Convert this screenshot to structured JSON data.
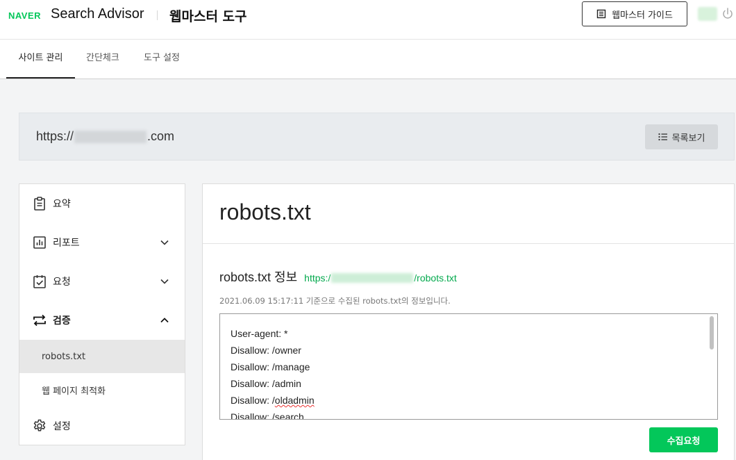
{
  "header": {
    "logo": "NAVER",
    "app_name": "Search Advisor",
    "tool_name": "웹마스터 도구",
    "guide_label": "웹마스터 가이드"
  },
  "tabs": [
    {
      "label": "사이트 관리",
      "active": true
    },
    {
      "label": "간단체크",
      "active": false
    },
    {
      "label": "도구 설정",
      "active": false
    }
  ],
  "site": {
    "url_prefix": "https://",
    "url_suffix": ".com",
    "list_label": "목록보기"
  },
  "sidebar": {
    "items": [
      {
        "label": "요약",
        "icon": "clipboard-icon"
      },
      {
        "label": "리포트",
        "icon": "chart-icon",
        "expanded": false
      },
      {
        "label": "요청",
        "icon": "clipboard-check-icon",
        "expanded": false
      },
      {
        "label": "검증",
        "icon": "repeat-icon",
        "expanded": true
      },
      {
        "label": "설정",
        "icon": "gear-icon"
      }
    ],
    "sub_items": [
      {
        "label": "robots.txt",
        "active": true
      },
      {
        "label": "웹 페이지 최적화",
        "active": false
      }
    ]
  },
  "main": {
    "title": "robots.txt",
    "section_title": "robots.txt 정보",
    "link_prefix": "https:/",
    "link_suffix": "/robots.txt",
    "caption": "2021.06.09 15:17:11 기준으로 수집된 robots.txt의 정보입니다.",
    "robots_lines": [
      "User-agent: *",
      "Disallow: /owner",
      "Disallow: /manage",
      "Disallow: /admin",
      "Disallow: /oldadmin",
      "Disallow: /search"
    ],
    "collect_label": "수집요청"
  },
  "colors": {
    "brand_green": "#03c75a",
    "link_green": "#03a94d"
  }
}
